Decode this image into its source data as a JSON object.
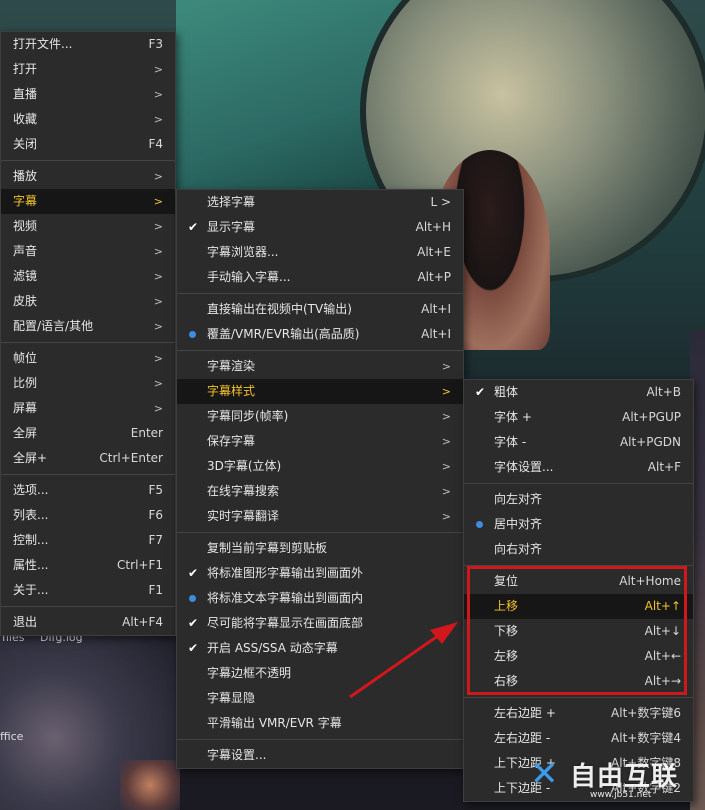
{
  "main_menu": [
    {
      "label": "打开文件...",
      "shortcut": "F3"
    },
    {
      "label": "打开",
      "arrow": ">"
    },
    {
      "label": "直播",
      "arrow": ">"
    },
    {
      "label": "收藏",
      "arrow": ">"
    },
    {
      "label": "关闭",
      "shortcut": "F4"
    },
    {
      "sep": true
    },
    {
      "label": "播放",
      "arrow": ">"
    },
    {
      "label": "字幕",
      "arrow": ">",
      "highlight": true
    },
    {
      "label": "视频",
      "arrow": ">"
    },
    {
      "label": "声音",
      "arrow": ">"
    },
    {
      "label": "滤镜",
      "arrow": ">"
    },
    {
      "label": "皮肤",
      "arrow": ">"
    },
    {
      "label": "配置/语言/其他",
      "arrow": ">"
    },
    {
      "sep": true
    },
    {
      "label": "帧位",
      "arrow": ">"
    },
    {
      "label": "比例",
      "arrow": ">"
    },
    {
      "label": "屏幕",
      "arrow": ">"
    },
    {
      "label": "全屏",
      "shortcut": "Enter"
    },
    {
      "label": "全屏+",
      "shortcut": "Ctrl+Enter"
    },
    {
      "sep": true
    },
    {
      "label": "选项...",
      "shortcut": "F5"
    },
    {
      "label": "列表...",
      "shortcut": "F6"
    },
    {
      "label": "控制...",
      "shortcut": "F7"
    },
    {
      "label": "属性...",
      "shortcut": "Ctrl+F1"
    },
    {
      "label": "关于...",
      "shortcut": "F1"
    },
    {
      "sep": true
    },
    {
      "label": "退出",
      "shortcut": "Alt+F4"
    }
  ],
  "subtitle_menu": [
    {
      "label": "选择字幕",
      "shortcut": "L >"
    },
    {
      "label": "显示字幕",
      "shortcut": "Alt+H",
      "mark": "check"
    },
    {
      "label": "字幕浏览器...",
      "shortcut": "Alt+E"
    },
    {
      "label": "手动输入字幕...",
      "shortcut": "Alt+P"
    },
    {
      "sep": true
    },
    {
      "label": "直接输出在视频中(TV输出)",
      "shortcut": "Alt+I"
    },
    {
      "label": "覆盖/VMR/EVR输出(高品质)",
      "shortcut": "Alt+I",
      "mark": "radio"
    },
    {
      "sep": true
    },
    {
      "label": "字幕渲染",
      "arrow": ">"
    },
    {
      "label": "字幕样式",
      "arrow": ">",
      "highlight": true
    },
    {
      "label": "字幕同步(帧率)",
      "arrow": ">"
    },
    {
      "label": "保存字幕",
      "arrow": ">"
    },
    {
      "label": "3D字幕(立体)",
      "arrow": ">"
    },
    {
      "label": "在线字幕搜索",
      "arrow": ">"
    },
    {
      "label": "实时字幕翻译",
      "arrow": ">"
    },
    {
      "sep": true
    },
    {
      "label": "复制当前字幕到剪贴板"
    },
    {
      "label": "将标准图形字幕输出到画面外",
      "mark": "check"
    },
    {
      "label": "将标准文本字幕输出到画面内",
      "mark": "radio"
    },
    {
      "label": "尽可能将字幕显示在画面底部",
      "mark": "check"
    },
    {
      "label": "开启 ASS/SSA 动态字幕",
      "mark": "check"
    },
    {
      "label": "字幕边框不透明"
    },
    {
      "label": "字幕显隐"
    },
    {
      "label": "平滑输出 VMR/EVR 字幕"
    },
    {
      "sep": true
    },
    {
      "label": "字幕设置..."
    }
  ],
  "style_menu": [
    {
      "label": "粗体",
      "shortcut": "Alt+B",
      "mark": "check"
    },
    {
      "label": "字体 +",
      "shortcut": "Alt+PGUP"
    },
    {
      "label": "字体 -",
      "shortcut": "Alt+PGDN"
    },
    {
      "label": "字体设置...",
      "shortcut": "Alt+F"
    },
    {
      "sep": true
    },
    {
      "label": "向左对齐"
    },
    {
      "label": "居中对齐",
      "mark": "radio"
    },
    {
      "label": "向右对齐"
    },
    {
      "sep": true
    },
    {
      "label": "复位",
      "shortcut": "Alt+Home"
    },
    {
      "label": "上移",
      "shortcut": "Alt+↑",
      "highlight": true
    },
    {
      "label": "下移",
      "shortcut": "Alt+↓"
    },
    {
      "label": "左移",
      "shortcut": "Alt+←"
    },
    {
      "label": "右移",
      "shortcut": "Alt+→"
    },
    {
      "sep": true
    },
    {
      "label": "左右边距 +",
      "shortcut": "Alt+数字键6"
    },
    {
      "label": "左右边距 -",
      "shortcut": "Alt+数字键4"
    },
    {
      "label": "上下边距 +",
      "shortcut": "Alt+数字键8"
    },
    {
      "label": "上下边距 -",
      "shortcut": "Alt+数字键2"
    }
  ],
  "desktop": {
    "label_files": "files",
    "label_dlog": "Dlfg.log",
    "label_office": "ffice"
  },
  "watermark": {
    "brand": "自由互联",
    "sub": "www.jb51.net"
  },
  "colors": {
    "highlight_text": "#f3c22c",
    "radio": "#3c8de0",
    "annotation_red": "#d0171c"
  }
}
